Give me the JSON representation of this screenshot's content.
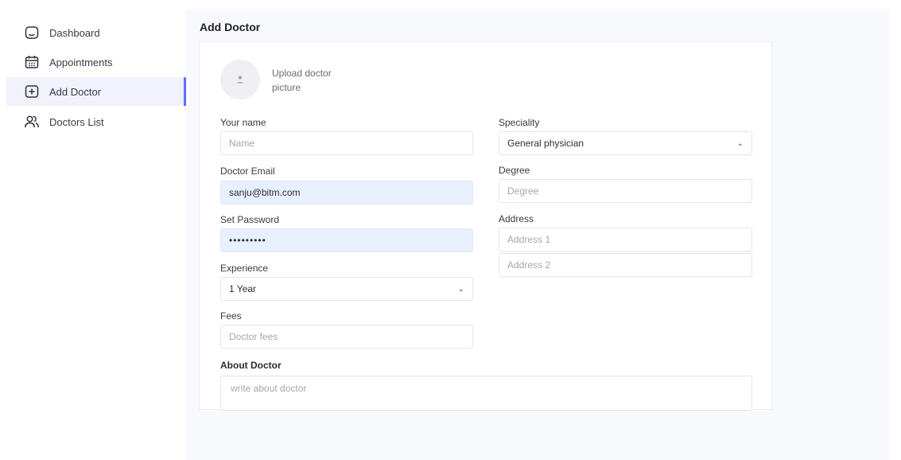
{
  "sidebar": {
    "items": [
      {
        "label": "Dashboard",
        "icon": "home-icon"
      },
      {
        "label": "Appointments",
        "icon": "calendar-icon"
      },
      {
        "label": "Add Doctor",
        "icon": "add-icon",
        "active": true
      },
      {
        "label": "Doctors List",
        "icon": "people-icon"
      }
    ]
  },
  "main": {
    "title": "Add Doctor",
    "upload_label": "Upload doctor picture",
    "form": {
      "name_label": "Your name",
      "name_placeholder": "Name",
      "email_label": "Doctor Email",
      "email_value": "sanju@bitm.com",
      "password_label": "Set Password",
      "password_value": "•••••••••",
      "experience_label": "Experience",
      "experience_value": "1 Year",
      "fees_label": "Fees",
      "fees_placeholder": "Doctor fees",
      "speciality_label": "Speciality",
      "speciality_value": "General physician",
      "degree_label": "Degree",
      "degree_placeholder": "Degree",
      "address_label": "Address",
      "address1_placeholder": "Address 1",
      "address2_placeholder": "Address 2",
      "about_label": "About Doctor",
      "about_placeholder": "write about doctor"
    }
  },
  "colors": {
    "accent": "#5f6fff",
    "active_bg": "#f1f2fb",
    "filled_input_bg": "#e8effd",
    "main_bg": "#f8f9fd"
  }
}
